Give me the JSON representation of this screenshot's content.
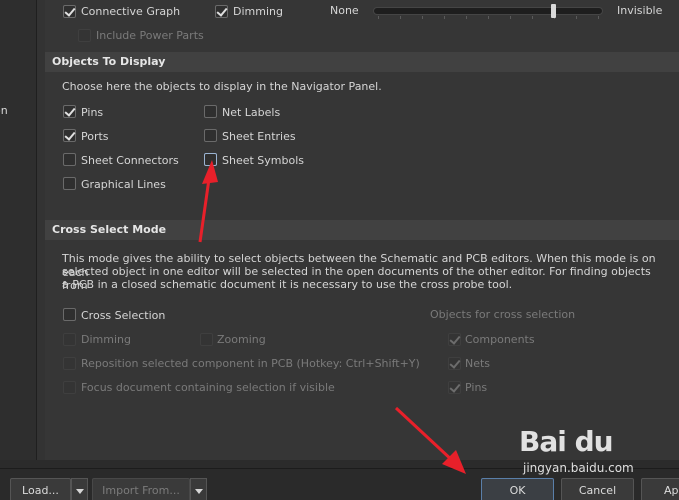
{
  "top_options": {
    "connective_graph": {
      "label": "Connective Graph",
      "checked": true
    },
    "dimming": {
      "label": "Dimming",
      "checked": true
    },
    "include_power_parts": {
      "label": "Include Power Parts",
      "checked": false,
      "disabled": true
    },
    "slider": {
      "min_label": "None",
      "max_label": "Invisible",
      "level": 0.8
    }
  },
  "objects_to_display": {
    "title": "Objects To Display",
    "description": "Choose here the objects to display in the Navigator Panel.",
    "items": [
      {
        "label": "Pins",
        "checked": true
      },
      {
        "label": "Net Labels",
        "checked": false
      },
      {
        "label": "Ports",
        "checked": true
      },
      {
        "label": "Sheet Entries",
        "checked": false
      },
      {
        "label": "Sheet Connectors",
        "checked": false
      },
      {
        "label": "Sheet Symbols",
        "checked": false
      },
      {
        "label": "Graphical Lines",
        "checked": false
      }
    ]
  },
  "cross_select": {
    "title": "Cross Select Mode",
    "description_lines": [
      "This mode gives the ability to select objects between the Schematic and PCB editors.  When this mode is on each",
      "selected object in one editor will be selected in the open documents of the other editor.  For finding objects from",
      "a PCB in a closed schematic document it is necessary to use the cross probe tool."
    ],
    "cross_selection": {
      "label": "Cross Selection",
      "checked": false
    },
    "dimming": {
      "label": "Dimming"
    },
    "zooming": {
      "label": "Zooming"
    },
    "reposition": {
      "label": "Reposition selected component in PCB (Hotkey: Ctrl+Shift+Y)"
    },
    "focus": {
      "label": "Focus document containing selection if visible"
    },
    "objects_header": "Objects for cross selection",
    "objects": [
      {
        "label": "Components",
        "checked": true
      },
      {
        "label": "Nets",
        "checked": true
      },
      {
        "label": "Pins",
        "checked": true
      }
    ]
  },
  "left_clip_text": "on",
  "footer": {
    "load": "Load...",
    "import_from": "Import From...",
    "ok": "OK",
    "cancel": "Cancel",
    "apply": "Ap"
  },
  "watermark": {
    "brand": "Bai du",
    "site": "jingyan.baidu.com"
  }
}
